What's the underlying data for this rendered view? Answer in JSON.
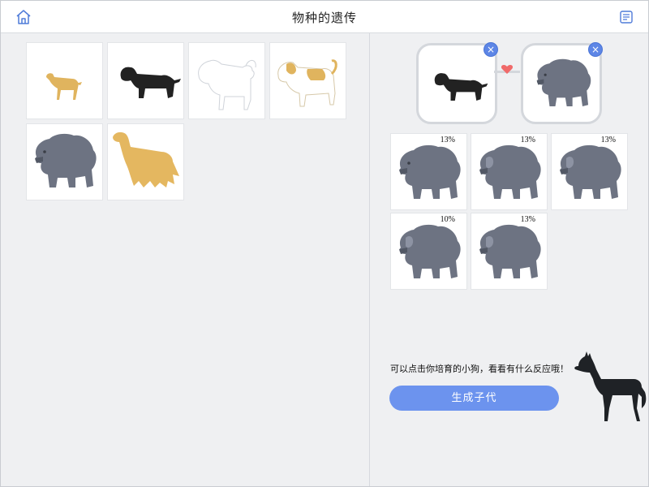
{
  "header": {
    "title": "物种的遗传",
    "home_icon": "home-icon",
    "notes_icon": "notes-icon"
  },
  "breeds": [
    {
      "icon": "small-tan-dog",
      "color": "#e0b45e"
    },
    {
      "icon": "black-dog",
      "color": "#222222"
    },
    {
      "icon": "white-fluffy-dog",
      "color": "#ffffff"
    },
    {
      "icon": "tan-white-dog",
      "color": "#e0b45e"
    },
    {
      "icon": "gray-chow-dog",
      "color": "#6d7382"
    },
    {
      "icon": "golden-longhair-dog",
      "color": "#e4b760"
    }
  ],
  "parents": {
    "left": {
      "icon": "black-dog"
    },
    "right": {
      "icon": "gray-chow-dog"
    },
    "remove_label": "×",
    "heart_color": "#f06a6a"
  },
  "offspring": [
    {
      "percent": "13%",
      "icon": "gray-chow-dog"
    },
    {
      "percent": "13%",
      "icon": "gray-chow-dog"
    },
    {
      "percent": "13%",
      "icon": "gray-chow-dog"
    },
    {
      "percent": "10%",
      "icon": "gray-chow-dog"
    },
    {
      "percent": "13%",
      "icon": "gray-chow-dog"
    }
  ],
  "hint_text": "可以点击你培育的小狗，看看有什么反应哦！",
  "generate_button": "生成子代",
  "colors": {
    "accent": "#6c93ee",
    "remove": "#5d86e6",
    "chow": "#6d7382"
  }
}
